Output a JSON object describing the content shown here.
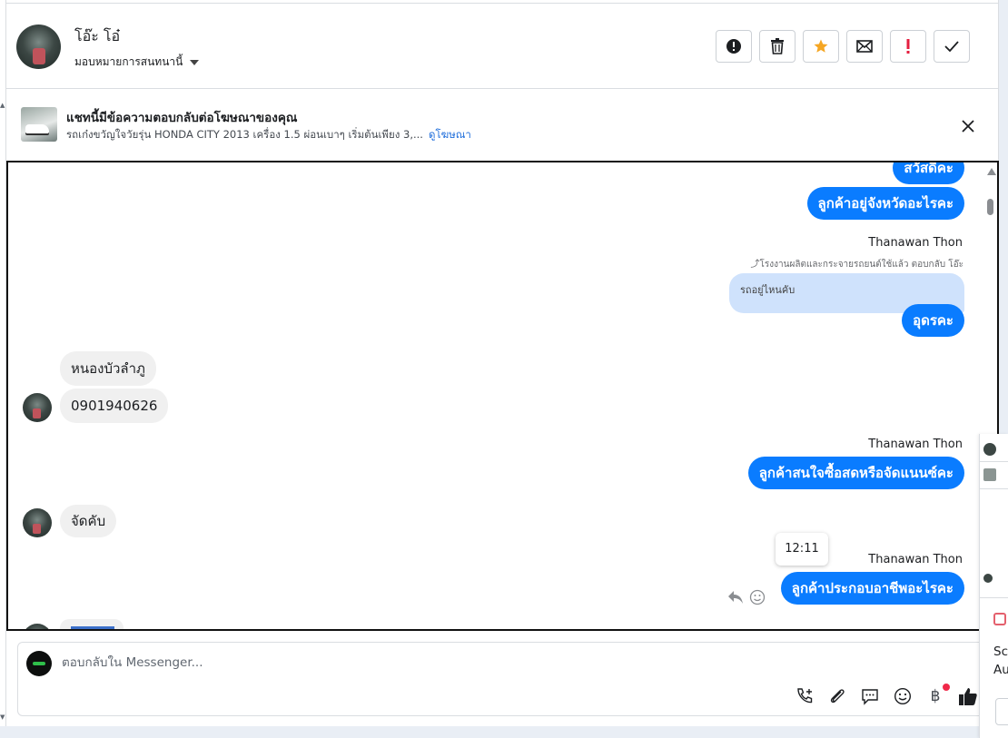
{
  "header": {
    "contact_name": "โอ๊ะ โอ๋",
    "assign_label": "มอบหมายการสนทนานี้"
  },
  "actions": [
    {
      "name": "report-button",
      "icon": "alert-circle-icon"
    },
    {
      "name": "delete-button",
      "icon": "trash-icon"
    },
    {
      "name": "star-button",
      "icon": "star-icon"
    },
    {
      "name": "mark-unread-button",
      "icon": "envelope-icon"
    },
    {
      "name": "important-button",
      "icon": "exclamation-icon"
    },
    {
      "name": "done-button",
      "icon": "check-icon"
    }
  ],
  "ad": {
    "title": "แชทนี้มีข้อความตอบกลับต่อโฆษณาของคุณ",
    "description": "รถเก๋งขวัญใจวัยรุ่น HONDA CITY 2013 เครื่อง 1.5 ผ่อนเบาๆ เริ่มต้นเพียง 3,...",
    "link": "ดูโฆษณา"
  },
  "messages": {
    "m1": "สวัสดีคะ",
    "m2": "ลูกค้าอยู่จังหวัดอะไรคะ",
    "sender1": "Thanawan Thon",
    "reply_note": "โรงงานผลิตและกระจายรถยนต์ใช้แล้ว ตอบกลับ โอ๊ะ",
    "quoted": "รถอยู่ไหนคับ",
    "m3": "อุดรคะ",
    "in1": "หนองบัวลำภู",
    "in2": "0901940626",
    "sender2": "Thanawan Thon",
    "m4": "ลูกค้าสนใจซื้อสดหรือจัดแนนซ์คะ",
    "in3": "จัดคับ",
    "time_tooltip": "12:11",
    "sender3": "Thanawan Thon",
    "m5": "ลูกค้าประกอบอาชีพอะไรคะ"
  },
  "composer": {
    "placeholder": "ตอบกลับใน Messenger...",
    "baht_symbol": "฿"
  },
  "side_panel": {
    "text1": "Sc",
    "text2": "Au"
  },
  "colors": {
    "outgoing_bubble": "#0a7cff",
    "incoming_bubble": "#f0f0f0",
    "quoted_bubble": "#cfe2fc",
    "star": "#f5a623",
    "important": "#e41e3f",
    "link": "#216fdb"
  }
}
